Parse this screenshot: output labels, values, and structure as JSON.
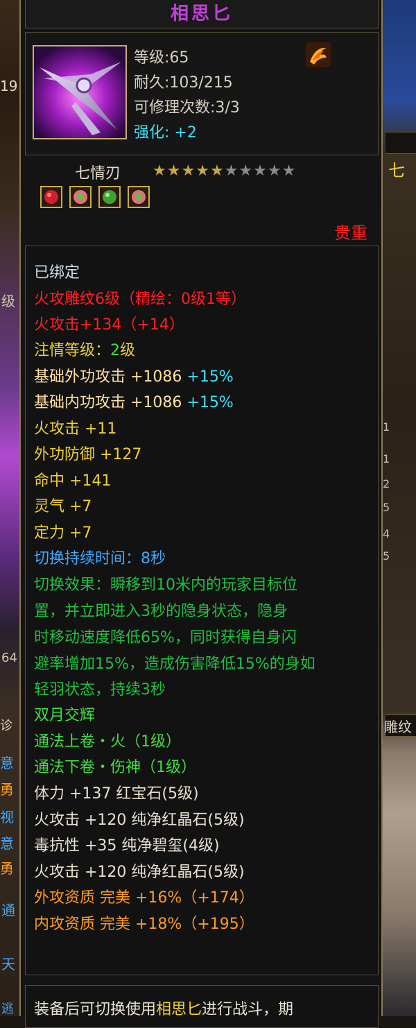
{
  "item": {
    "name": "相思匕",
    "level": "等级:65",
    "durability": "耐久:103/215",
    "repair_count": "可修理次数:3/3",
    "enhance_label": "强化:",
    "enhance_value": "+2",
    "sub_name": "七情刃",
    "stars_filled": 5,
    "stars_total": 10,
    "rarity": "贵重",
    "gems": [
      "red-gem-icon",
      "pink-gem-icon",
      "green-gem-icon",
      "pink-gem-icon"
    ],
    "colors": {
      "title": "#c040d8",
      "rarity": "#ff2020"
    }
  },
  "attributes": [
    {
      "text": "已绑定",
      "color": "bound"
    },
    {
      "text": "火攻雕纹6级（精绘：0级1等）",
      "color": "red"
    },
    {
      "text": "火攻击+134（+14）",
      "color": "red"
    },
    {
      "text": "注情等级：",
      "suffix": "2",
      "tail": "级",
      "color": "yellow",
      "suffix_color": "green"
    },
    {
      "text": "基础外功攻击 +1086 ",
      "suffix": "+15%",
      "color": "pale",
      "suffix_color": "cyan"
    },
    {
      "text": "基础内功攻击 +1086 ",
      "suffix": "+15%",
      "color": "pale",
      "suffix_color": "cyan"
    },
    {
      "text": "火攻击 +11",
      "color": "yellow"
    },
    {
      "text": "外功防御 +127",
      "color": "yellow"
    },
    {
      "text": "命中 +141",
      "color": "yellow"
    },
    {
      "text": "灵气 +7",
      "color": "yellow"
    },
    {
      "text": "定力 +7",
      "color": "yellow"
    },
    {
      "text": "切换持续时间：8秒",
      "color": "blue"
    },
    {
      "text": "切换效果：瞬移到10米内的玩家目标位",
      "color": "dgreen"
    },
    {
      "text": "置，并立即进入3秒的隐身状态，隐身",
      "color": "dgreen"
    },
    {
      "text": "时移动速度降低65%，同时获得自身闪",
      "color": "dgreen"
    },
    {
      "text": "避率增加15%，造成伤害降低15%的身如",
      "color": "dgreen"
    },
    {
      "text": "轻羽状态，持续3秒",
      "color": "dgreen"
    },
    {
      "text": "双月交辉",
      "color": "green"
    },
    {
      "text": "通法上卷・火（1级）",
      "color": "green"
    },
    {
      "text": "通法下卷・伤神（1级）",
      "color": "green"
    },
    {
      "text": "体力 +137 红宝石(5级)",
      "color": "white"
    },
    {
      "text": "火攻击 +120 纯净红晶石(5级)",
      "color": "white"
    },
    {
      "text": "毒抗性 +35 纯净碧玺(4级)",
      "color": "white"
    },
    {
      "text": "火攻击 +120 纯净红晶石(5级)",
      "color": "white"
    },
    {
      "text": "外攻资质  完美 +16%（+174）",
      "color": "orange"
    },
    {
      "text": "内攻资质  完美 +18%（+195）",
      "color": "orange"
    }
  ],
  "footer": {
    "text_a": "装备后可切换使用",
    "text_b": "相思匕",
    "text_c": "进行战斗，期"
  },
  "background": {
    "left_glyphs": [
      "19",
      "级",
      "64",
      "诊",
      "意",
      "勇",
      "视",
      "意",
      "勇",
      "通",
      "天",
      "逃"
    ],
    "right_glyphs": [
      "七",
      "雕纹",
      "1",
      "1",
      "2",
      "5",
      "4",
      "5"
    ]
  }
}
